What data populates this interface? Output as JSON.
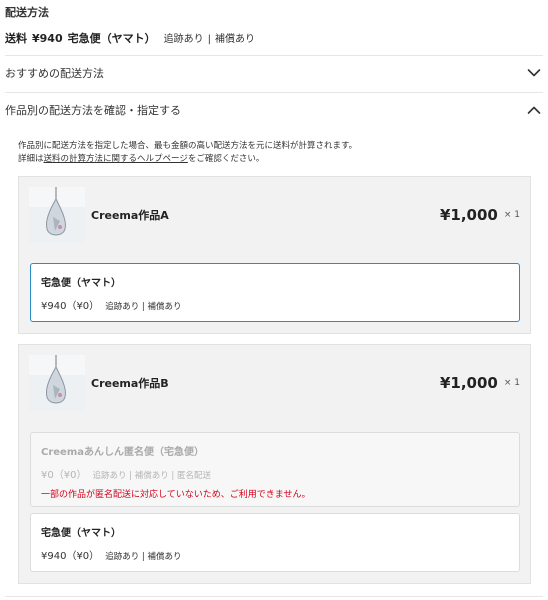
{
  "header": {
    "title": "配送方法"
  },
  "summary": {
    "label": "送料",
    "price": "¥940",
    "method": "宅急便（ヤマト）",
    "tracking": "追跡あり",
    "separator": "|",
    "insurance": "補償あり"
  },
  "accordions": {
    "recommended": {
      "label": "おすすめの配送方法"
    },
    "per_item": {
      "label": "作品別の配送方法を確認・指定する"
    }
  },
  "description": {
    "line1": "作品別に配送方法を指定した場合、最も金額の高い配送方法を元に送料が計算されます。",
    "line2_prefix": "詳細は",
    "link": "送料の計算方法に関するヘルプページ",
    "line2_suffix": "をご確認ください。"
  },
  "items": [
    {
      "name": "Creema作品A",
      "price": "¥1,000",
      "qty": "× 1",
      "options": [
        {
          "title": "宅急便（ヤマト）",
          "price": "¥940（¥0）",
          "tags": "追跡あり | 補償あり",
          "selected": true
        }
      ]
    },
    {
      "name": "Creema作品B",
      "price": "¥1,000",
      "qty": "× 1",
      "options": [
        {
          "title": "Creemaあんしん匿名便（宅急便）",
          "price": "¥0（¥0）",
          "tags": "追跡あり | 補償あり | 匿名配送",
          "warning": "一部の作品が匿名配送に対応していないため、ご利用できません。",
          "disabled": true
        },
        {
          "title": "宅急便（ヤマト）",
          "price": "¥940（¥0）",
          "tags": "追跡あり | 補償あり"
        }
      ]
    }
  ],
  "colors": {
    "selected_border": "#2b8cc4",
    "warning": "#d0021b",
    "card_bg": "#f2f2f2"
  },
  "icons": {
    "recommended_toggle": "chevron-down-icon",
    "per_item_toggle": "chevron-up-icon",
    "thumbnail": "drop-pendant-image"
  }
}
